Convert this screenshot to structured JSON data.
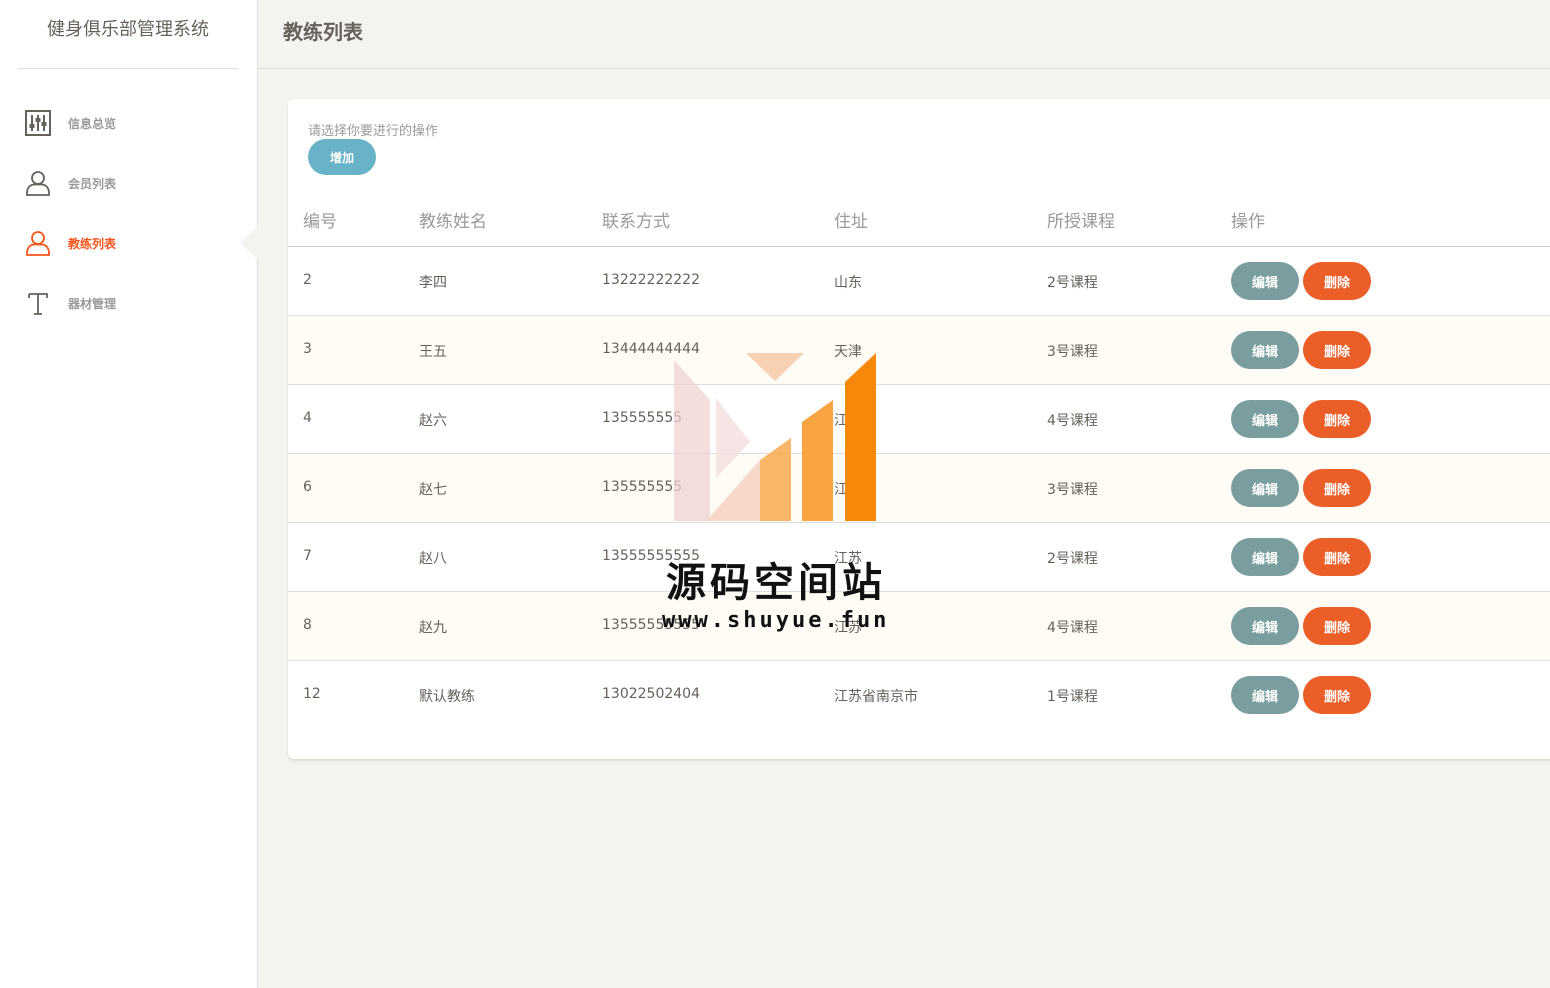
{
  "app": {
    "title": "健身俱乐部管理系统"
  },
  "sidebar": {
    "items": [
      {
        "label": "信息总览",
        "icon": "panel-settings-icon",
        "active": false
      },
      {
        "label": "会员列表",
        "icon": "user-icon",
        "active": false
      },
      {
        "label": "教练列表",
        "icon": "user-icon",
        "active": true
      },
      {
        "label": "器材管理",
        "icon": "text-t-icon",
        "active": false
      }
    ]
  },
  "header": {
    "title": "教练列表"
  },
  "card": {
    "hint": "请选择你要进行的操作",
    "add_label": "增加"
  },
  "table": {
    "headers": [
      "编号",
      "教练姓名",
      "联系方式",
      "住址",
      "所授课程",
      "操作"
    ],
    "rows": [
      {
        "id": "2",
        "name": "李四",
        "phone": "13222222222",
        "address": "山东",
        "course": "2号课程"
      },
      {
        "id": "3",
        "name": "王五",
        "phone": "13444444444",
        "address": "天津",
        "course": "3号课程"
      },
      {
        "id": "4",
        "name": "赵六",
        "phone": "135555555",
        "address": "江",
        "course": "4号课程"
      },
      {
        "id": "6",
        "name": "赵七",
        "phone": "135555555",
        "address": "江",
        "course": "3号课程"
      },
      {
        "id": "7",
        "name": "赵八",
        "phone": "13555555555",
        "address": "江苏",
        "course": "2号课程"
      },
      {
        "id": "8",
        "name": "赵九",
        "phone": "13555555555",
        "address": "江苏",
        "course": "4号课程"
      },
      {
        "id": "12",
        "name": "默认教练",
        "phone": "13022502404",
        "address": "江苏省南京市",
        "course": "1号课程"
      }
    ],
    "edit_label": "编辑",
    "delete_label": "删除"
  },
  "watermark": {
    "title": "源码空间站",
    "url": "www.shuyue.fun"
  },
  "colors": {
    "accent": "#eb5e28",
    "info": "#68b3c8",
    "edit": "#7a9e9f",
    "active_nav": "#f4561d"
  }
}
